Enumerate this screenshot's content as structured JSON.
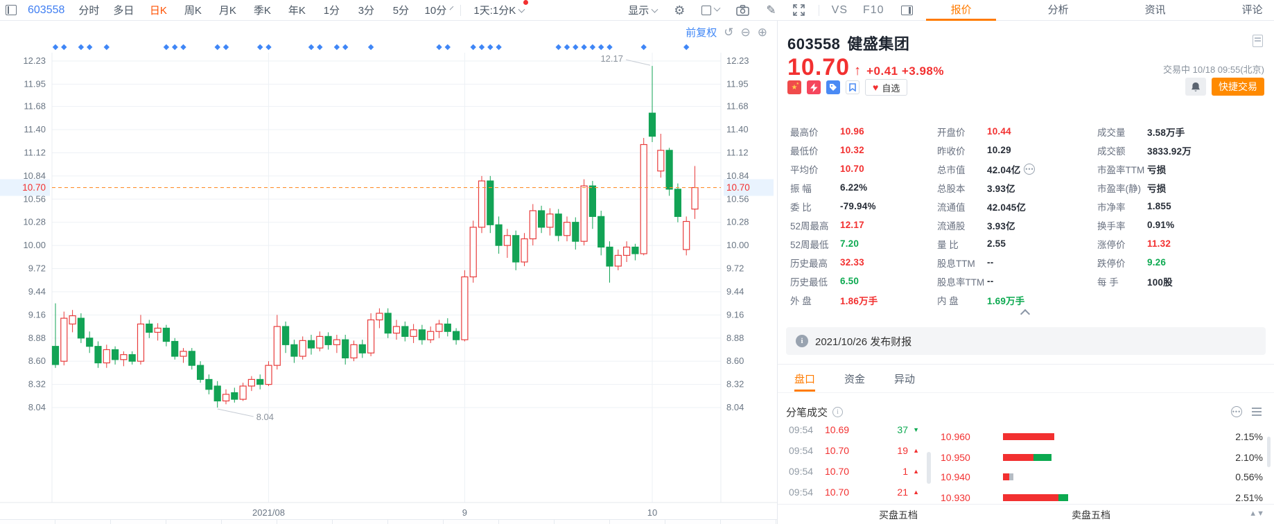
{
  "toolbar": {
    "stock_code": "603558",
    "periods": [
      "分时",
      "多日",
      "日K",
      "周K",
      "月K",
      "季K",
      "年K",
      "1分",
      "3分",
      "5分",
      "10分"
    ],
    "active_period": "日K",
    "period_combo": "1天:1分K",
    "display_label": "显示",
    "vs_label": "VS",
    "f10_label": "F10"
  },
  "top_tabs": {
    "items": [
      "报价",
      "分析",
      "资讯",
      "评论"
    ],
    "active": "报价"
  },
  "chart_data": {
    "type": "candlestick",
    "title": "603558 健盛集团 日K 前复权",
    "adjust_label": "前复权",
    "y_ticks": [
      "12.23",
      "11.95",
      "11.68",
      "11.40",
      "11.12",
      "10.84",
      "10.56",
      "10.28",
      "10.00",
      "9.72",
      "9.44",
      "9.16",
      "8.88",
      "8.60",
      "8.32",
      "8.04"
    ],
    "y_range": [
      8.04,
      12.23
    ],
    "current_price": "10.70",
    "current_price_value": 10.7,
    "x_labels": [
      {
        "index": 25,
        "label": "2021/08"
      },
      {
        "index": 48,
        "label": "9"
      },
      {
        "index": 70,
        "label": "10"
      }
    ],
    "annotations": [
      {
        "label": "12.17",
        "index": 70,
        "at": "high"
      },
      {
        "label": "8.04",
        "index": 19,
        "at": "low"
      }
    ],
    "event_marker_indices": [
      0,
      1,
      3,
      4,
      6,
      13,
      14,
      15,
      19,
      20,
      24,
      25,
      30,
      31,
      33,
      34,
      37,
      45,
      46,
      49,
      50,
      51,
      52,
      59,
      60,
      61,
      62,
      63,
      64,
      65,
      69,
      74
    ],
    "candles": [
      [
        8.78,
        9.3,
        8.52,
        8.56
      ],
      [
        8.6,
        9.2,
        8.55,
        9.12
      ],
      [
        9.05,
        9.22,
        8.95,
        9.15
      ],
      [
        9.12,
        9.18,
        8.82,
        8.88
      ],
      [
        8.88,
        8.96,
        8.7,
        8.78
      ],
      [
        8.78,
        8.84,
        8.52,
        8.58
      ],
      [
        8.58,
        8.8,
        8.52,
        8.74
      ],
      [
        8.74,
        8.78,
        8.56,
        8.62
      ],
      [
        8.62,
        8.72,
        8.54,
        8.68
      ],
      [
        8.68,
        8.72,
        8.56,
        8.6
      ],
      [
        8.6,
        9.16,
        8.56,
        9.05
      ],
      [
        9.05,
        9.1,
        8.88,
        8.95
      ],
      [
        8.95,
        9.06,
        8.85,
        9.0
      ],
      [
        9.0,
        9.04,
        8.78,
        8.84
      ],
      [
        8.84,
        8.88,
        8.62,
        8.66
      ],
      [
        8.66,
        8.76,
        8.58,
        8.72
      ],
      [
        8.72,
        8.76,
        8.5,
        8.55
      ],
      [
        8.55,
        8.6,
        8.34,
        8.38
      ],
      [
        8.38,
        8.44,
        8.2,
        8.26
      ],
      [
        8.3,
        8.36,
        8.04,
        8.12
      ],
      [
        8.12,
        8.26,
        8.08,
        8.2
      ],
      [
        8.22,
        8.28,
        8.1,
        8.14
      ],
      [
        8.14,
        8.34,
        8.12,
        8.3
      ],
      [
        8.3,
        8.42,
        8.24,
        8.38
      ],
      [
        8.38,
        8.44,
        8.26,
        8.32
      ],
      [
        8.32,
        8.6,
        8.3,
        8.55
      ],
      [
        8.55,
        9.16,
        8.5,
        9.02
      ],
      [
        9.02,
        9.08,
        8.7,
        8.8
      ],
      [
        8.8,
        8.86,
        8.58,
        8.66
      ],
      [
        8.66,
        8.9,
        8.62,
        8.85
      ],
      [
        8.85,
        8.92,
        8.68,
        8.76
      ],
      [
        8.76,
        8.96,
        8.72,
        8.9
      ],
      [
        8.9,
        8.95,
        8.74,
        8.8
      ],
      [
        8.8,
        8.92,
        8.7,
        8.86
      ],
      [
        8.86,
        8.92,
        8.56,
        8.64
      ],
      [
        8.64,
        8.85,
        8.6,
        8.8
      ],
      [
        8.8,
        8.86,
        8.64,
        8.7
      ],
      [
        8.7,
        9.18,
        8.66,
        9.1
      ],
      [
        9.1,
        9.24,
        9.0,
        9.18
      ],
      [
        9.18,
        9.24,
        8.88,
        8.94
      ],
      [
        8.94,
        9.1,
        8.86,
        9.02
      ],
      [
        9.02,
        9.08,
        8.84,
        8.9
      ],
      [
        8.9,
        9.05,
        8.82,
        8.98
      ],
      [
        8.98,
        9.04,
        8.8,
        8.86
      ],
      [
        8.86,
        9.02,
        8.82,
        8.96
      ],
      [
        8.96,
        9.1,
        8.88,
        9.05
      ],
      [
        9.05,
        9.12,
        8.9,
        8.96
      ],
      [
        8.96,
        9.0,
        8.8,
        8.86
      ],
      [
        8.86,
        9.7,
        8.84,
        9.62
      ],
      [
        9.62,
        10.3,
        9.55,
        10.22
      ],
      [
        10.22,
        10.84,
        10.15,
        10.78
      ],
      [
        10.78,
        10.84,
        10.15,
        10.25
      ],
      [
        10.25,
        10.35,
        9.9,
        10.0
      ],
      [
        10.0,
        10.2,
        9.85,
        10.12
      ],
      [
        10.12,
        10.18,
        9.7,
        9.8
      ],
      [
        9.8,
        10.15,
        9.75,
        10.08
      ],
      [
        10.08,
        10.5,
        10.0,
        10.42
      ],
      [
        10.42,
        10.48,
        10.15,
        10.22
      ],
      [
        10.22,
        10.45,
        10.12,
        10.38
      ],
      [
        10.38,
        10.44,
        10.05,
        10.12
      ],
      [
        10.12,
        10.35,
        10.05,
        10.28
      ],
      [
        10.28,
        10.34,
        9.95,
        10.05
      ],
      [
        10.05,
        10.8,
        10.0,
        10.72
      ],
      [
        10.72,
        10.78,
        10.2,
        10.35
      ],
      [
        10.35,
        10.42,
        9.88,
        9.98
      ],
      [
        9.98,
        10.05,
        9.55,
        9.75
      ],
      [
        9.75,
        9.95,
        9.7,
        9.88
      ],
      [
        9.88,
        10.05,
        9.8,
        9.98
      ],
      [
        9.98,
        10.02,
        9.82,
        9.9
      ],
      [
        9.9,
        11.3,
        9.88,
        11.22
      ],
      [
        11.6,
        12.17,
        11.25,
        11.32
      ],
      [
        10.9,
        11.35,
        10.82,
        11.15
      ],
      [
        11.15,
        11.18,
        10.6,
        10.68
      ],
      [
        10.68,
        10.75,
        10.28,
        10.35
      ],
      [
        9.95,
        10.35,
        9.88,
        10.29
      ],
      [
        10.44,
        10.96,
        10.32,
        10.7
      ]
    ]
  },
  "quote": {
    "code": "603558",
    "name": "健盛集团",
    "price": "10.70",
    "arrow": "↑",
    "change": "+0.41",
    "change_pct": "+3.98%",
    "status": "交易中 10/18 09:55(北京)",
    "favorite_label": "自选",
    "quick_trade_label": "快捷交易",
    "stats": [
      {
        "l": "最高价",
        "v": "10.96",
        "c": "r"
      },
      {
        "l": "开盘价",
        "v": "10.44",
        "c": "r"
      },
      {
        "l": "成交量",
        "v": "3.58万手",
        "c": "d"
      },
      {
        "l": "最低价",
        "v": "10.32",
        "c": "r"
      },
      {
        "l": "昨收价",
        "v": "10.29",
        "c": "d"
      },
      {
        "l": "成交额",
        "v": "3833.92万",
        "c": "d"
      },
      {
        "l": "平均价",
        "v": "10.70",
        "c": "r"
      },
      {
        "l": "总市值",
        "v": "42.04亿",
        "c": "d",
        "icon": true
      },
      {
        "l": "市盈率TTM",
        "v": "亏损",
        "c": "d"
      },
      {
        "l": "振  幅",
        "v": "6.22%",
        "c": "d"
      },
      {
        "l": "总股本",
        "v": "3.93亿",
        "c": "d"
      },
      {
        "l": "市盈率(静)",
        "v": "亏损",
        "c": "d"
      },
      {
        "l": "委  比",
        "v": "-79.94%",
        "c": "d"
      },
      {
        "l": "流通值",
        "v": "42.045亿",
        "c": "d"
      },
      {
        "l": "市净率",
        "v": "1.855",
        "c": "d"
      },
      {
        "l": "52周最高",
        "v": "12.17",
        "c": "r"
      },
      {
        "l": "流通股",
        "v": "3.93亿",
        "c": "d"
      },
      {
        "l": "换手率",
        "v": "0.91%",
        "c": "d"
      },
      {
        "l": "52周最低",
        "v": "7.20",
        "c": "g"
      },
      {
        "l": "量  比",
        "v": "2.55",
        "c": "d"
      },
      {
        "l": "涨停价",
        "v": "11.32",
        "c": "r"
      },
      {
        "l": "历史最高",
        "v": "32.33",
        "c": "r"
      },
      {
        "l": "股息TTM",
        "v": "--",
        "c": "d"
      },
      {
        "l": "跌停价",
        "v": "9.26",
        "c": "g"
      },
      {
        "l": "历史最低",
        "v": "6.50",
        "c": "g"
      },
      {
        "l": "股息率TTM",
        "v": "--",
        "c": "d"
      },
      {
        "l": "每  手",
        "v": "100股",
        "c": "d"
      },
      {
        "l": "外  盘",
        "v": "1.86万手",
        "c": "r"
      },
      {
        "l": "内  盘",
        "v": "1.69万手",
        "c": "g"
      }
    ],
    "notice": "2021/10/26 发布财报"
  },
  "panel_tabs": {
    "items": [
      "盘口",
      "资金",
      "异动"
    ],
    "active": "盘口"
  },
  "trades": {
    "title": "分笔成交",
    "rows": [
      {
        "time": "09:54",
        "price": "10.69",
        "vol": "37",
        "dir": "down"
      },
      {
        "time": "09:54",
        "price": "10.70",
        "vol": "19",
        "dir": "up"
      },
      {
        "time": "09:54",
        "price": "10.70",
        "vol": "1",
        "dir": "up"
      },
      {
        "time": "09:54",
        "price": "10.70",
        "vol": "21",
        "dir": "up"
      }
    ],
    "levels": [
      {
        "price": "10.960",
        "pct": "2.15%",
        "bar": [
          [
            "r",
            74
          ]
        ]
      },
      {
        "price": "10.950",
        "pct": "2.10%",
        "bar": [
          [
            "r",
            44
          ],
          [
            "g",
            26
          ]
        ]
      },
      {
        "price": "10.940",
        "pct": "0.56%",
        "bar": [
          [
            "r",
            9
          ],
          [
            "x",
            6
          ]
        ]
      },
      {
        "price": "10.930",
        "pct": "2.51%",
        "bar": [
          [
            "r",
            80
          ],
          [
            "g",
            14
          ]
        ]
      }
    ],
    "buy_label": "买盘五档",
    "sell_label": "卖盘五档"
  },
  "colors": {
    "up": "#f23030",
    "down": "#0ca950",
    "candle_up": "#e83b3b",
    "candle_down": "#12a355",
    "accent": "#ff7b00",
    "active_period": "#ff5000",
    "blue": "#3f7ef2",
    "dashed_line": "#ff8f2e",
    "axis_text": "#6a7684",
    "grid": "#edf1f5",
    "marker": "#3f86f6",
    "tag_bg": "#e9f3fe"
  }
}
